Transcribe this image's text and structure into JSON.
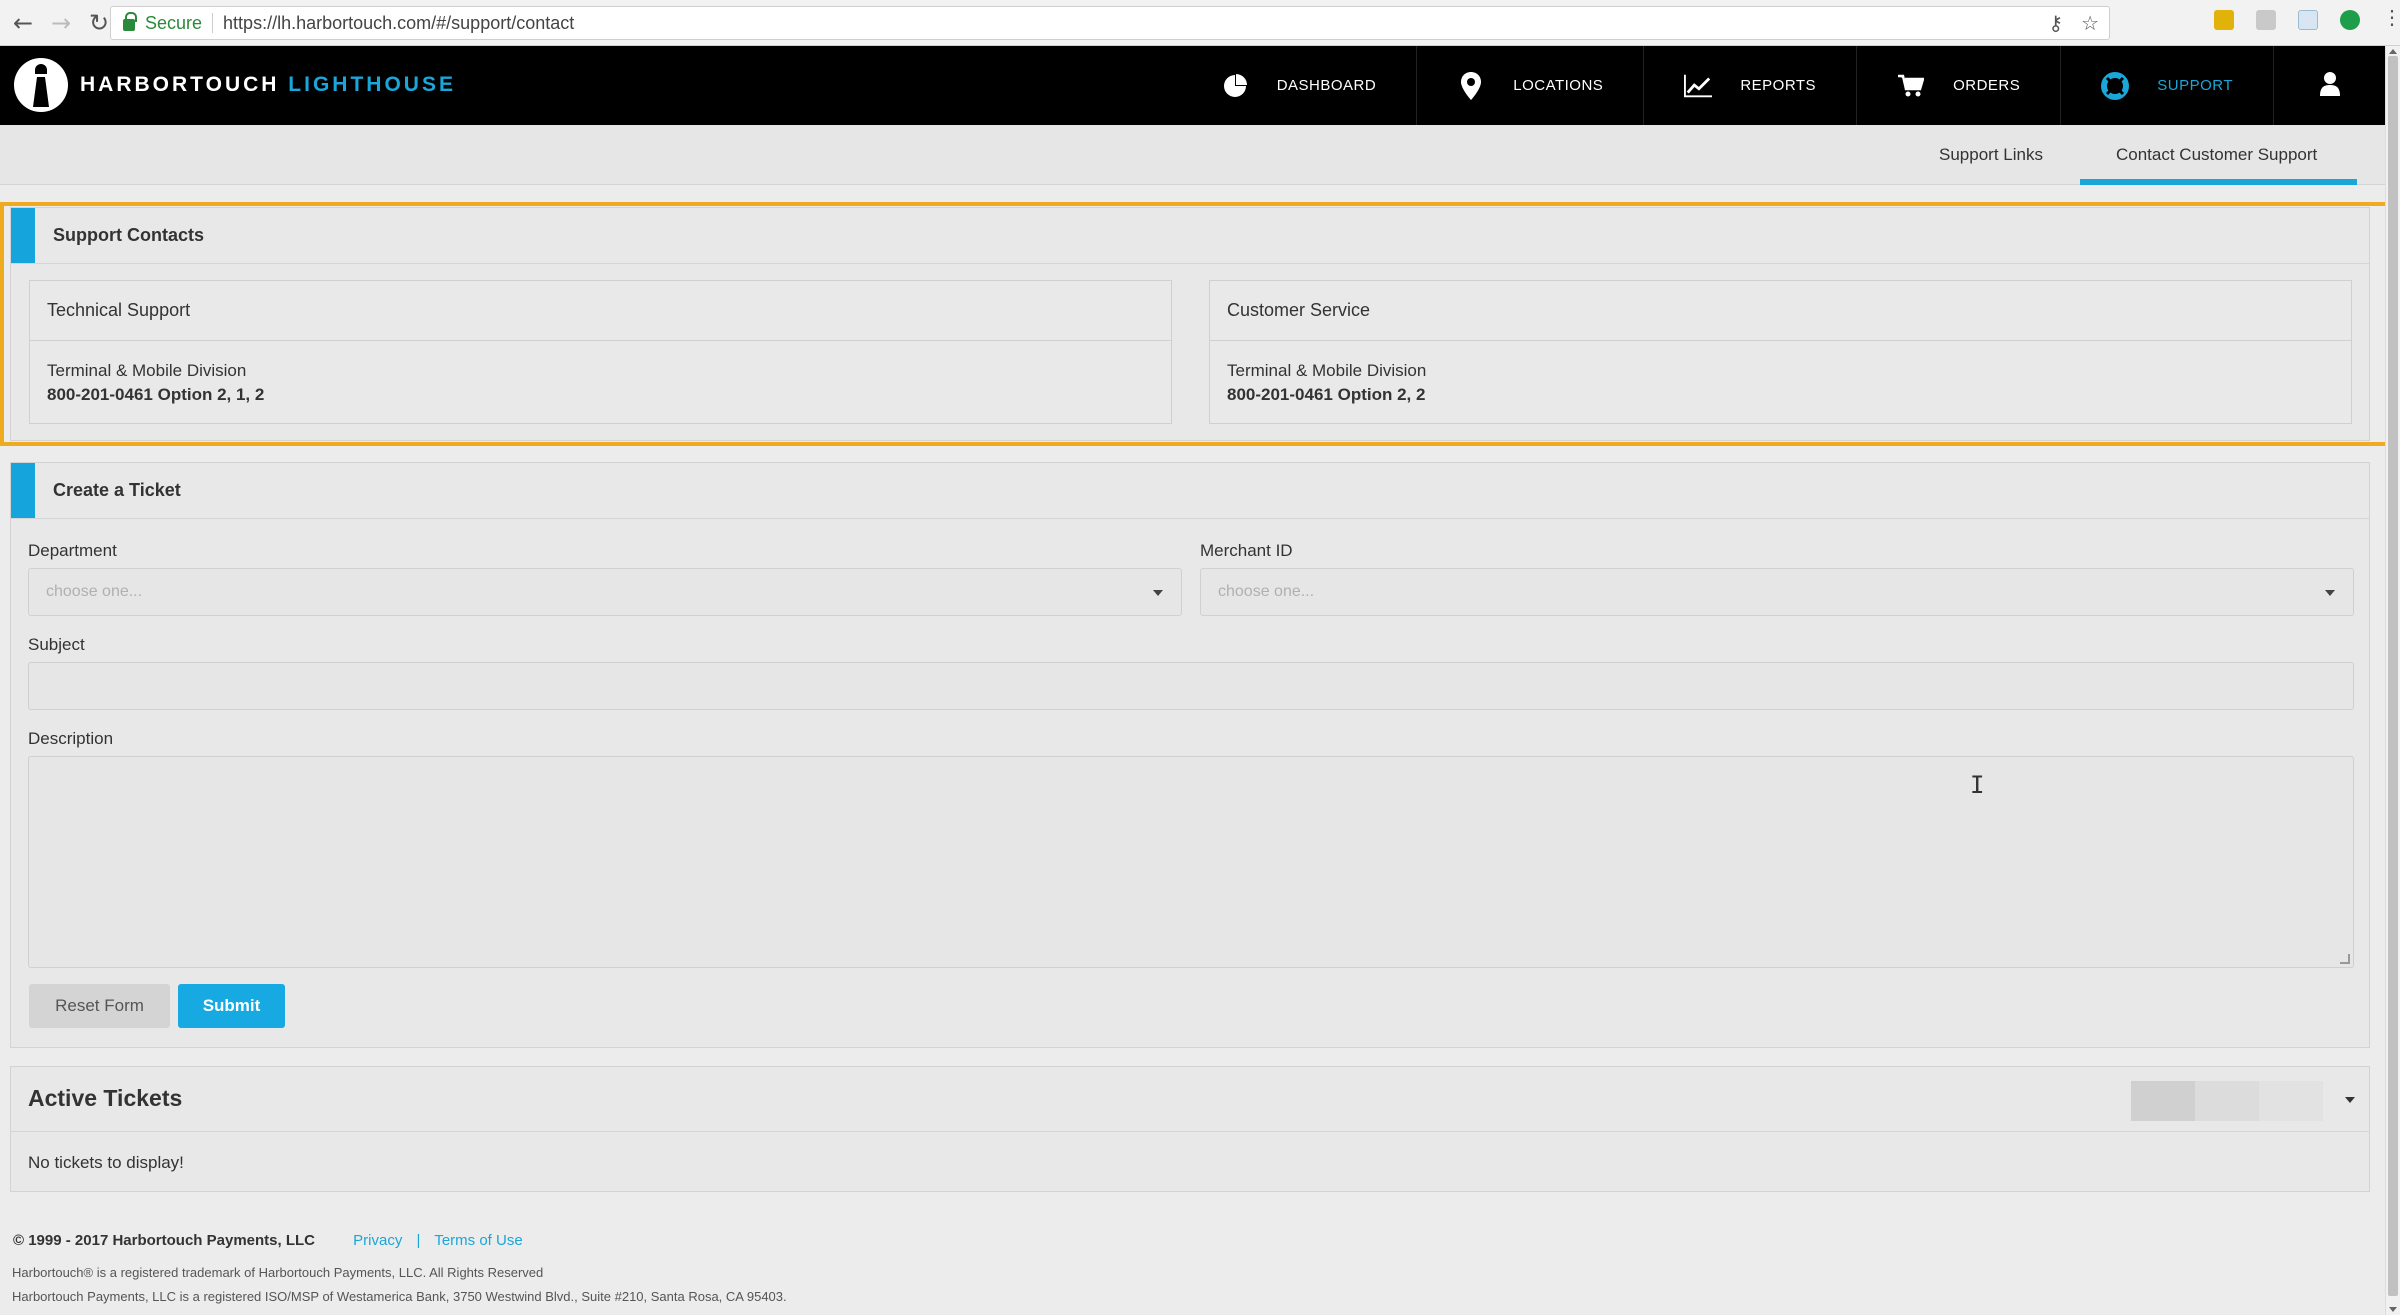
{
  "browser": {
    "secure_label": "Secure",
    "url": "https://lh.harbortouch.com/#/support/contact"
  },
  "brand": {
    "name_part1": "HARBORTOUCH",
    "name_part2": "LIGHTHOUSE"
  },
  "nav": {
    "items": [
      {
        "label": "DASHBOARD",
        "icon": "pie-chart-icon"
      },
      {
        "label": "LOCATIONS",
        "icon": "map-pin-icon"
      },
      {
        "label": "REPORTS",
        "icon": "line-chart-icon"
      },
      {
        "label": "ORDERS",
        "icon": "cart-icon"
      },
      {
        "label": "SUPPORT",
        "icon": "lifebuoy-icon"
      }
    ],
    "user_icon": "user-icon",
    "active_color": "#1aa6d8"
  },
  "subnav": {
    "tabs": [
      {
        "label": "Support Links"
      },
      {
        "label": "Contact Customer Support"
      }
    ]
  },
  "support_contacts": {
    "title": "Support Contacts",
    "cards": [
      {
        "title": "Technical Support",
        "division": "Terminal & Mobile Division",
        "phone": "800-201-0461 Option 2, 1, 2"
      },
      {
        "title": "Customer Service",
        "division": "Terminal & Mobile Division",
        "phone": "800-201-0461 Option 2, 2"
      }
    ],
    "highlight_color": "#efab20"
  },
  "ticket": {
    "title": "Create a Ticket",
    "department_label": "Department",
    "department_placeholder": "choose one...",
    "merchant_label": "Merchant ID",
    "merchant_placeholder": "choose one...",
    "subject_label": "Subject",
    "description_label": "Description",
    "reset_label": "Reset Form",
    "submit_label": "Submit"
  },
  "active_tickets": {
    "title": "Active Tickets",
    "empty_text": "No tickets to display!"
  },
  "footer": {
    "copyright": "© 1999 - 2017 Harbortouch Payments, LLC",
    "privacy": "Privacy",
    "separator": "|",
    "terms": "Terms of Use",
    "trademark_line": "Harbortouch® is a registered trademark of Harbortouch Payments, LLC. All Rights Reserved",
    "iso_line": "Harbortouch Payments, LLC is a registered ISO/MSP of Westamerica Bank, 3750 Westwind Blvd., Suite #210, Santa Rosa, CA 95403."
  },
  "colors": {
    "accent": "#15a4db",
    "header_bg": "#000000"
  }
}
